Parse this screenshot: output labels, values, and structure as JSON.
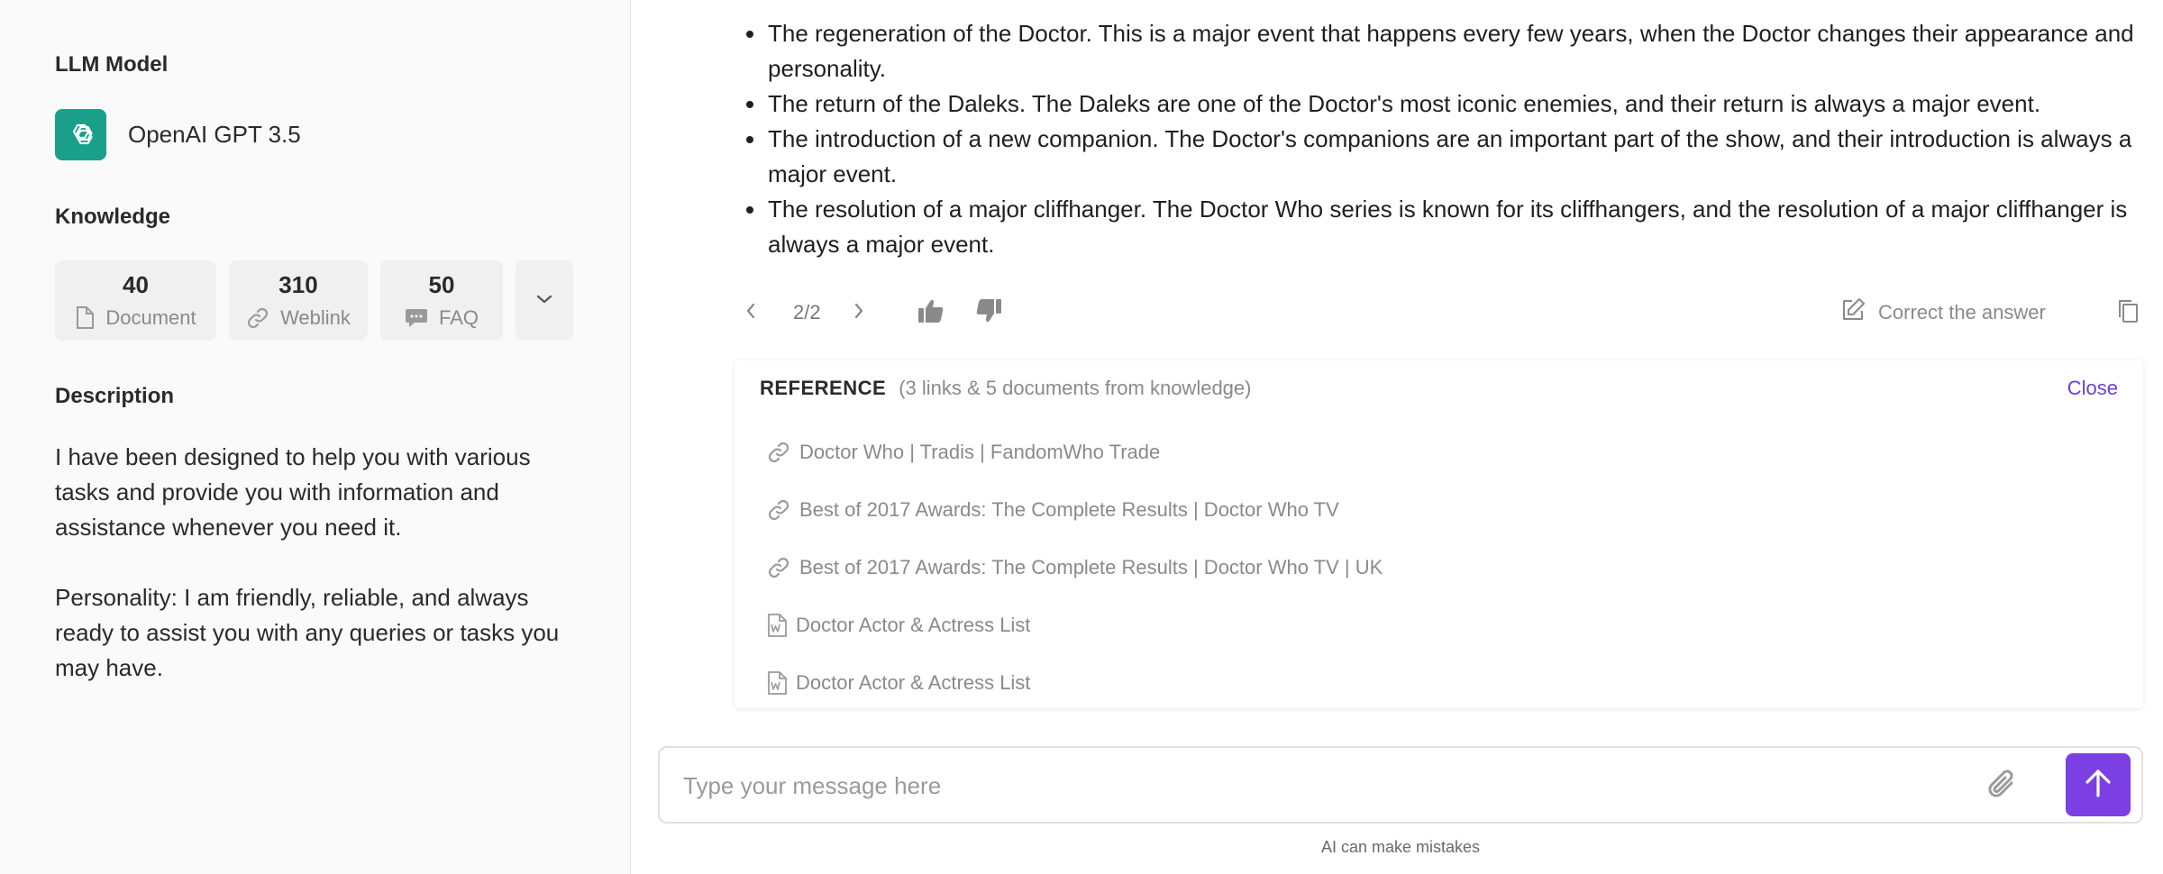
{
  "sidebar": {
    "llm_title": "LLM Model",
    "model_name": "OpenAI GPT 3.5",
    "knowledge_title": "Knowledge",
    "knowledge": [
      {
        "count": "40",
        "label": "Document"
      },
      {
        "count": "310",
        "label": "Weblink"
      },
      {
        "count": "50",
        "label": "FAQ"
      }
    ],
    "description_title": "Description",
    "description": [
      "I have been designed to help you with various tasks and provide you with information and assistance whenever you need it.",
      "Personality: I am friendly, reliable, and always ready to assist you with any queries or tasks you may have."
    ]
  },
  "answer": {
    "bullets": [
      "The regeneration of the Doctor. This is a major event that happens every few years, when the Doctor changes their appearance and personality.",
      "The return of the Daleks. The Daleks are one of the Doctor's most iconic enemies, and their return is always a major event.",
      "The introduction of a new companion. The Doctor's companions are an important part of the show, and their introduction is always a major event.",
      "The resolution of a major cliffhanger. The Doctor Who series is known for its cliffhangers, and the resolution of a major cliffhanger is always a major event."
    ]
  },
  "actions": {
    "pager": "2/2",
    "correct_label": "Correct the answer"
  },
  "reference": {
    "title": "REFERENCE",
    "subtitle": "(3 links & 5 documents from knowledge)",
    "close_label": "Close",
    "items": [
      {
        "type": "link",
        "label": "Doctor Who | Tradis | FandomWho Trade"
      },
      {
        "type": "link",
        "label": "Best of 2017 Awards: The Complete Results | Doctor Who TV"
      },
      {
        "type": "link",
        "label": "Best of 2017 Awards: The Complete Results | Doctor Who TV | UK"
      },
      {
        "type": "document",
        "label": "Doctor Actor & Actress List"
      },
      {
        "type": "document",
        "label": "Doctor Actor & Actress List"
      }
    ]
  },
  "composer": {
    "placeholder": "Type your message here",
    "value": ""
  },
  "footer": {
    "disclaimer": "AI can make mistakes"
  },
  "colors": {
    "accent": "#7b3fe4",
    "close_link": "#6b3fd4",
    "model_logo": "#1aa08a",
    "sidebar_bg": "#fafafa",
    "card_bg": "#f0f0f0"
  }
}
